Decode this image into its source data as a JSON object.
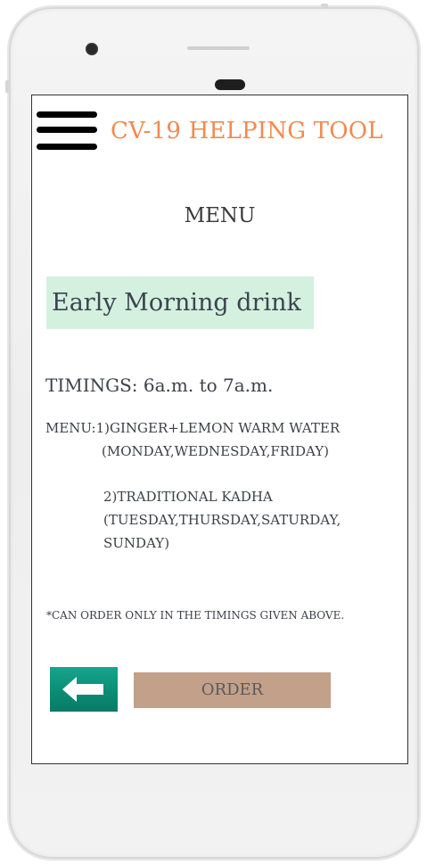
{
  "header": {
    "title": "CV-19 HELPING TOOL",
    "menu_icon": "hamburger-menu-icon"
  },
  "page": {
    "heading": "MENU",
    "drink_title": "Early Morning drink",
    "timings": "TIMINGS: 6a.m. to 7a.m.",
    "menu_items": [
      "MENU:1)GINGER+LEMON WARM WATER",
      "(MONDAY,WEDNESDAY,FRIDAY)",
      "2)TRADITIONAL KADHA",
      "(TUESDAY,THURSDAY,SATURDAY,",
      "SUNDAY)"
    ],
    "note": "*CAN ORDER ONLY IN THE TIMINGS GIVEN ABOVE."
  },
  "actions": {
    "back_icon": "left-arrow-icon",
    "order_label": "ORDER"
  },
  "colors": {
    "title": "#f28a4e",
    "banner_bg": "#d4f1df",
    "back_button": "#0f9a82",
    "order_button": "#c3a08a"
  }
}
